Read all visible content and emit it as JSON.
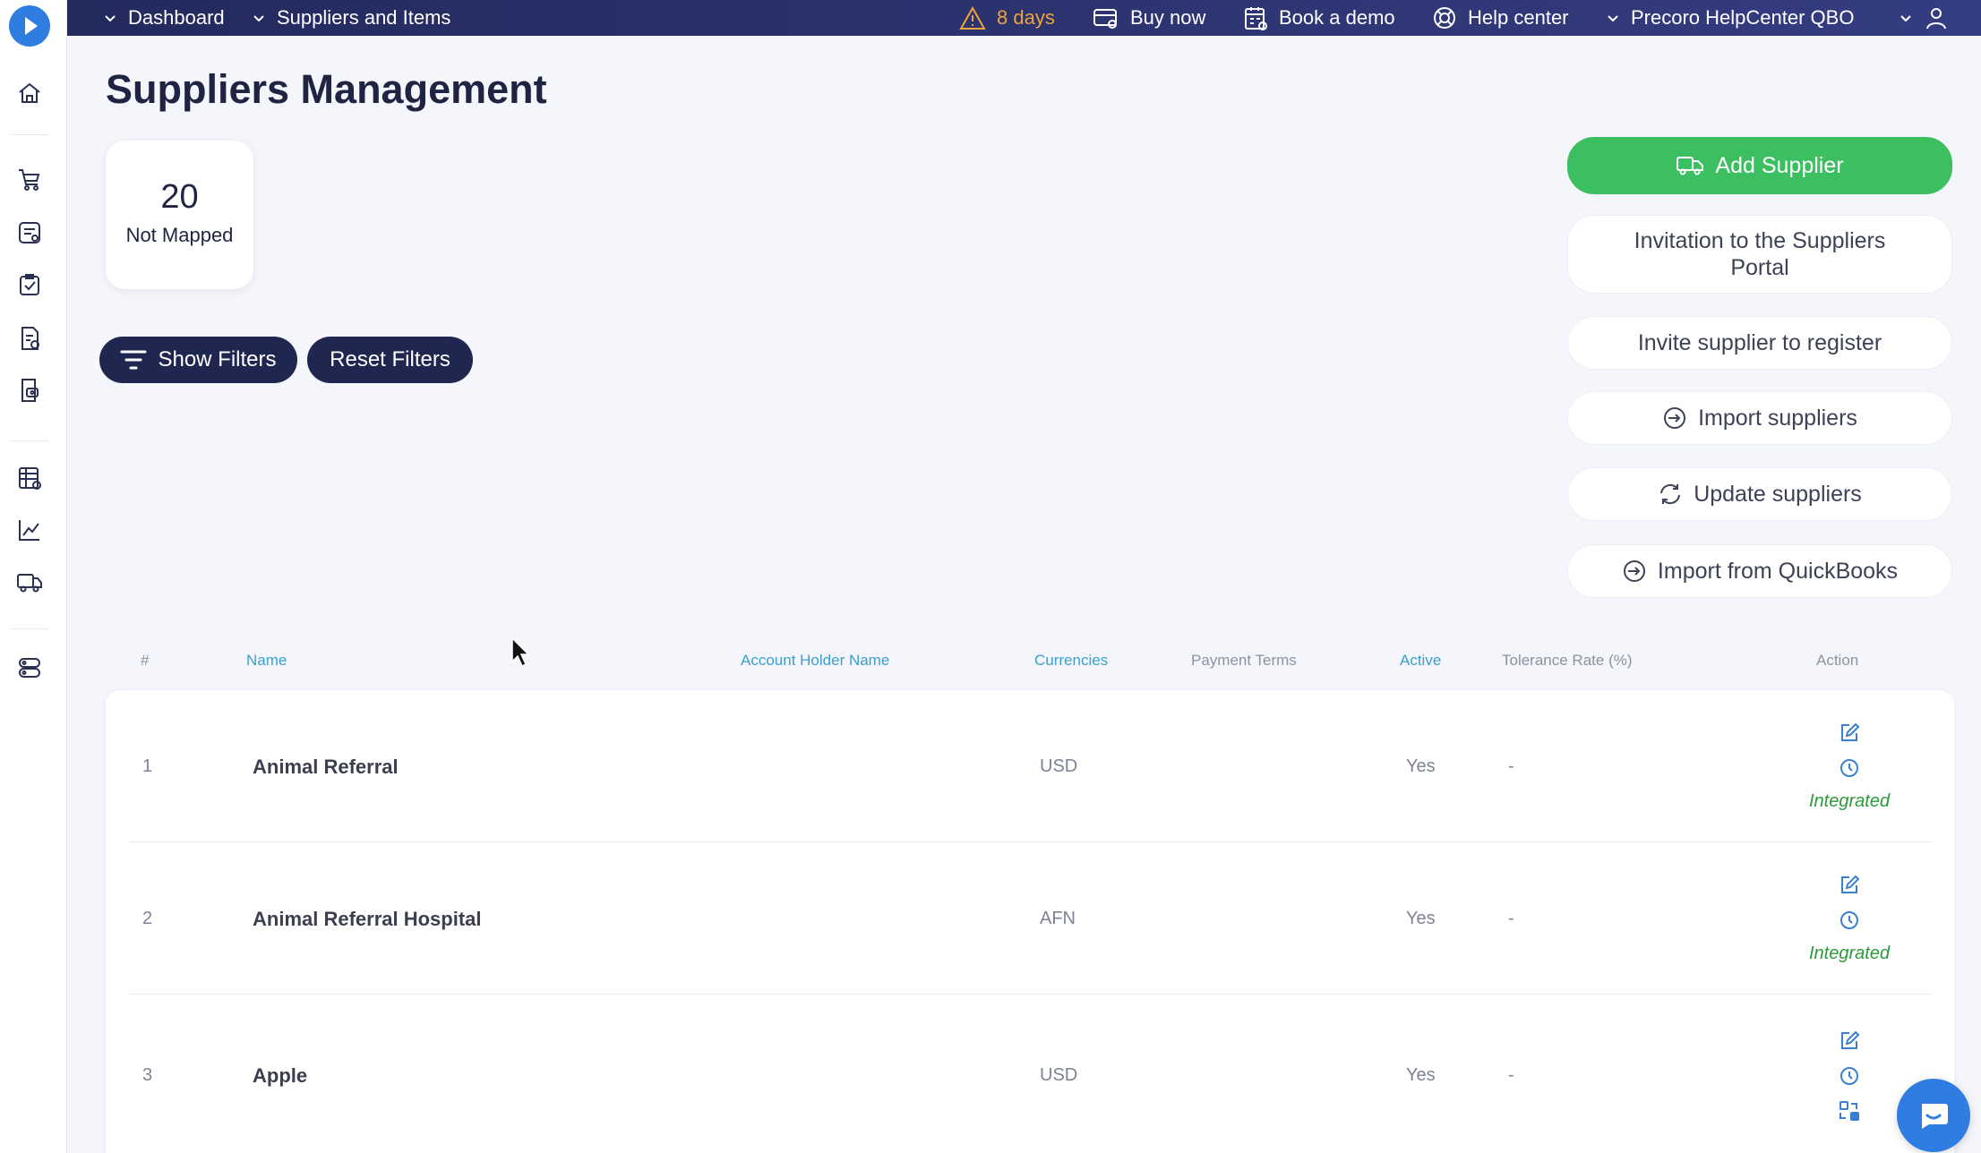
{
  "topbar": {
    "dashboard": "Dashboard",
    "suppliers_items": "Suppliers and Items",
    "trial": "8 days",
    "buy_now": "Buy now",
    "book_demo": "Book a demo",
    "help_center": "Help center",
    "company": "Precoro HelpCenter QBO"
  },
  "page": {
    "title": "Suppliers Management"
  },
  "stat": {
    "value": "20",
    "label": "Not Mapped"
  },
  "filters": {
    "show": "Show Filters",
    "reset": "Reset Filters"
  },
  "actions": {
    "add_supplier": "Add Supplier",
    "invitation_line1": "Invitation to the Suppliers",
    "invitation_line2": "Portal",
    "invite_register": "Invite supplier to register",
    "import_suppliers": "Import suppliers",
    "update_suppliers": "Update suppliers",
    "import_quickbooks": "Import from QuickBooks"
  },
  "table": {
    "headers": {
      "num": "#",
      "name": "Name",
      "account_holder": "Account Holder Name",
      "currencies": "Currencies",
      "payment_terms": "Payment Terms",
      "active": "Active",
      "tolerance": "Tolerance Rate (%)",
      "action": "Action"
    },
    "rows": [
      {
        "num": "1",
        "name": "Animal Referral",
        "currency": "USD",
        "active": "Yes",
        "tolerance": "-",
        "status": "Integrated"
      },
      {
        "num": "2",
        "name": "Animal Referral Hospital",
        "currency": "AFN",
        "active": "Yes",
        "tolerance": "-",
        "status": "Integrated"
      },
      {
        "num": "3",
        "name": "Apple",
        "currency": "USD",
        "active": "Yes",
        "tolerance": "-",
        "status": ""
      }
    ]
  },
  "colors": {
    "topbar": "#2d3573",
    "primary_dark": "#1f2650",
    "green": "#3cbf60",
    "link": "#3aa0cf",
    "warning": "#f0a23a",
    "integrated": "#2a9a3a",
    "accent_blue": "#2f7de1"
  },
  "icons": {
    "sidebar": [
      "logo-icon",
      "home-icon",
      "cart-icon",
      "requisition-icon",
      "approval-icon",
      "invoice-icon",
      "receipt-icon",
      "budget-icon",
      "reports-icon",
      "suppliers-icon",
      "settings-icon"
    ],
    "actions": [
      "edit-icon",
      "history-icon",
      "map-icon"
    ]
  }
}
